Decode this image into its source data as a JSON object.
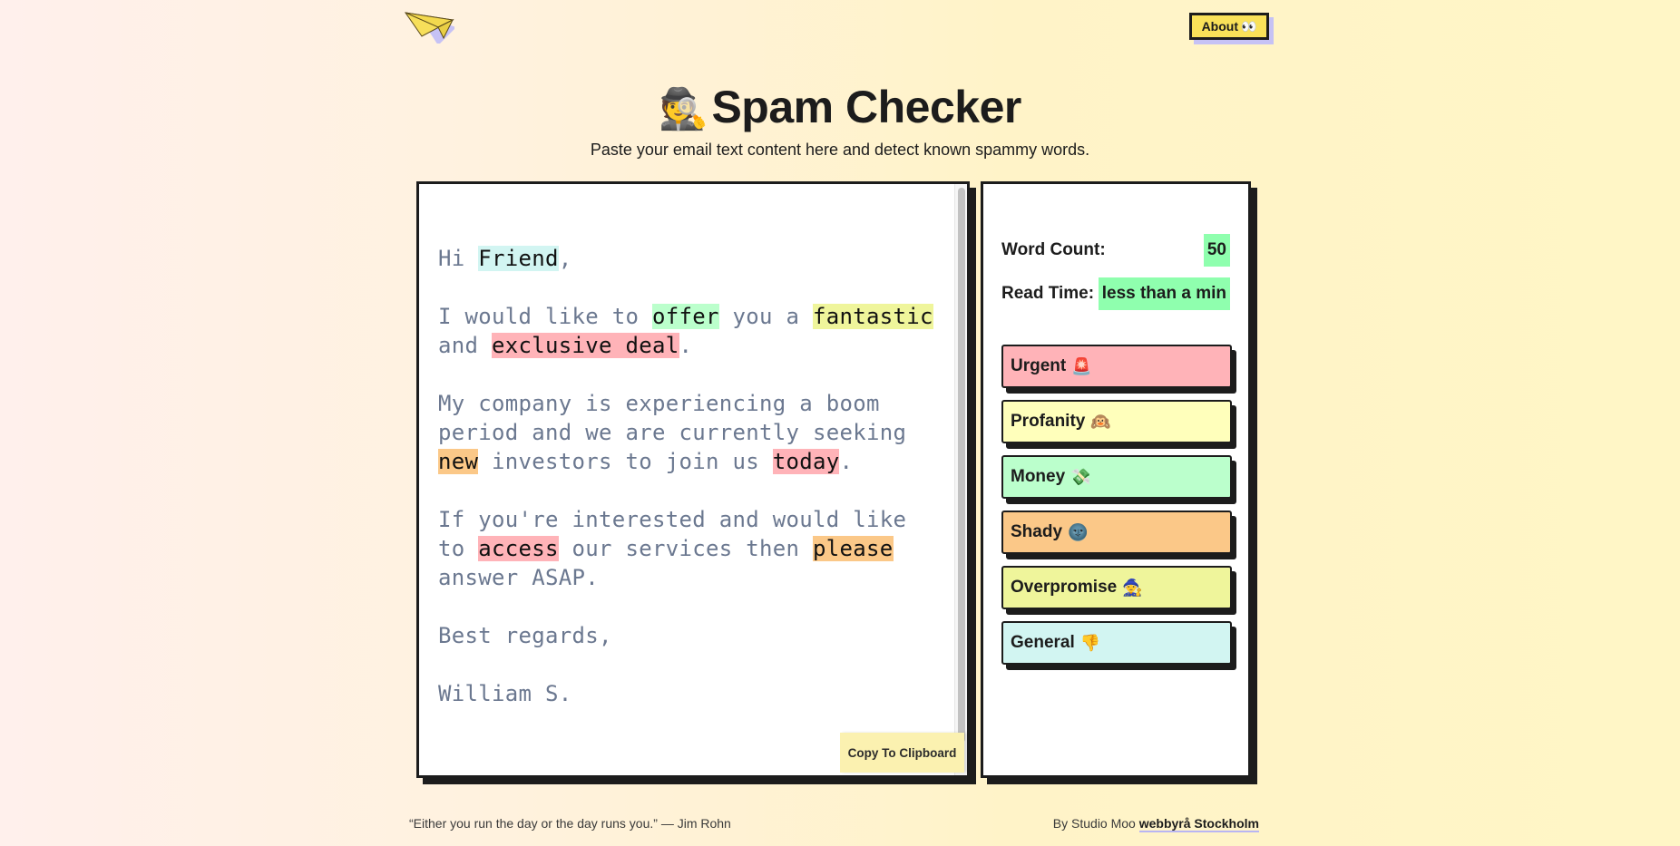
{
  "header": {
    "about_label": "About",
    "about_emoji": "👀"
  },
  "hero": {
    "emoji": "🕵️",
    "title": "Spam Checker",
    "subtitle": "Paste your email text content here and detect known spammy words."
  },
  "editor": {
    "paragraphs": [
      [
        {
          "t": "Hi "
        },
        {
          "t": "Friend",
          "c": "general"
        },
        {
          "t": ","
        }
      ],
      [
        {
          "t": "I would like to "
        },
        {
          "t": "offer",
          "c": "money"
        },
        {
          "t": " you a "
        },
        {
          "t": "fantastic",
          "c": "overpromise"
        },
        {
          "t": " and "
        },
        {
          "t": "exclusive deal",
          "c": "urgent"
        },
        {
          "t": "."
        }
      ],
      [
        {
          "t": "My company is experiencing a boom period and we are currently seeking "
        },
        {
          "t": "new",
          "c": "shady"
        },
        {
          "t": " investors to join us "
        },
        {
          "t": "today",
          "c": "urgent"
        },
        {
          "t": "."
        }
      ],
      [
        {
          "t": "If you're interested and would like to "
        },
        {
          "t": "access",
          "c": "urgent"
        },
        {
          "t": " our services then "
        },
        {
          "t": "please",
          "c": "shady"
        },
        {
          "t": " answer ASAP."
        }
      ],
      [
        {
          "t": "Best regards,"
        }
      ],
      [
        {
          "t": "William S."
        }
      ]
    ],
    "copy_label": "Copy To Clipboard"
  },
  "stats": {
    "word_count_label": "Word Count:",
    "word_count_value": "50",
    "read_time_label": "Read Time:",
    "read_time_value": "less than a min"
  },
  "categories": [
    {
      "key": "urgent",
      "label": "Urgent",
      "emoji": "🚨",
      "color": "#ffb3b8"
    },
    {
      "key": "profanity",
      "label": "Profanity",
      "emoji": "🙉",
      "color": "#ffffbb"
    },
    {
      "key": "money",
      "label": "Money",
      "emoji": "💸",
      "color": "#bbffcc"
    },
    {
      "key": "shady",
      "label": "Shady",
      "emoji": "🌚",
      "color": "#fbc888"
    },
    {
      "key": "overpromise",
      "label": "Overpromise",
      "emoji": "🧙",
      "color": "#eff59b"
    },
    {
      "key": "general",
      "label": "General",
      "emoji": "👎",
      "color": "#d2f5f2"
    }
  ],
  "footer": {
    "quote": "“Either you run the day or the day runs you.” — Jim Rohn",
    "by_text": "By Studio Moo ",
    "link_text": "webbyrå Stockholm"
  }
}
